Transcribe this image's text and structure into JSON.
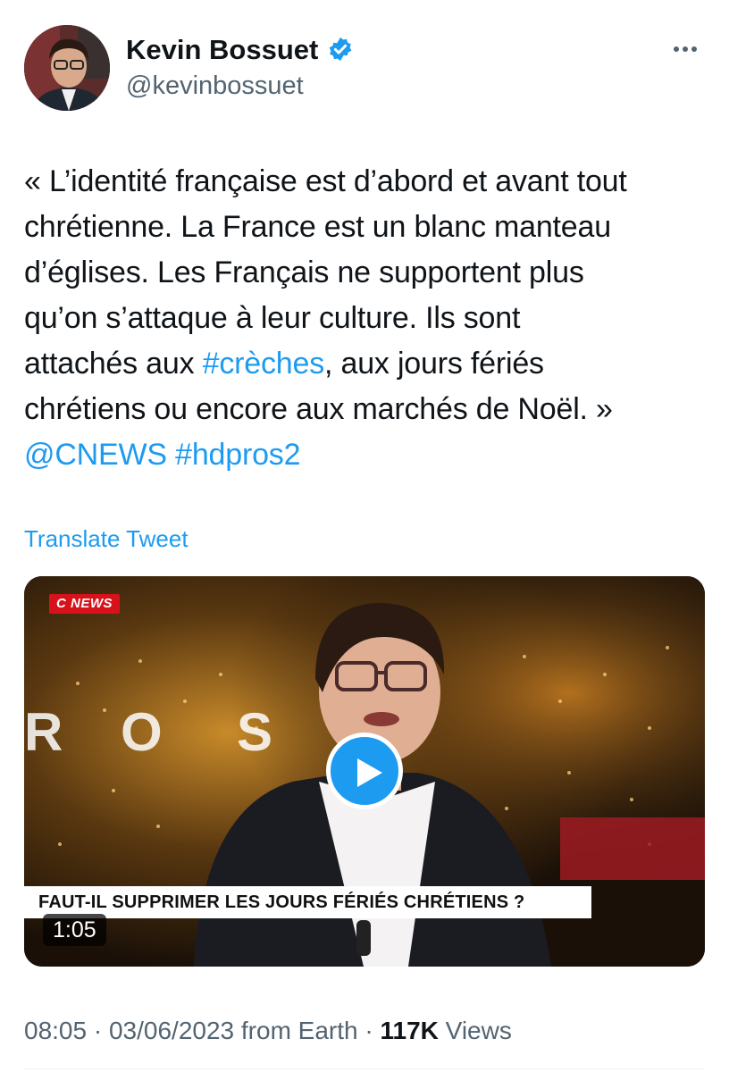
{
  "author": {
    "display_name": "Kevin Bossuet",
    "handle": "@kevinbossuet",
    "verified": true
  },
  "icons": {
    "verified": "verified-badge-icon",
    "more": "more-options-icon",
    "play": "play-icon"
  },
  "tweet": {
    "lines": [
      [
        {
          "text": "« L’identité française est d’abord et avant tout"
        }
      ],
      [
        {
          "text": "chrétienne. La France est un blanc manteau"
        }
      ],
      [
        {
          "text": "d’églises. Les Français ne supportent plus"
        }
      ],
      [
        {
          "text": "qu’on s’attaque à leur culture. Ils sont"
        }
      ],
      [
        {
          "text": "attachés aux "
        },
        {
          "text": "#crèches",
          "link": true
        },
        {
          "text": ", aux jours fériés"
        }
      ],
      [
        {
          "text": "chrétiens ou encore aux marchés de Noël. »"
        }
      ],
      [
        {
          "text": "@CNEWS",
          "link": true
        },
        {
          "text": " "
        },
        {
          "text": "#hdpros2",
          "link": true
        }
      ]
    ],
    "translate_label": "Translate Tweet"
  },
  "video": {
    "channel_logo": "C NEWS",
    "background_text": "R O S",
    "caption": "FAUT-IL SUPPRIMER LES JOURS FÉRIÉS CHRÉTIENS ?",
    "duration": "1:05"
  },
  "meta": {
    "time": "08:05",
    "separator": " · ",
    "date": "03/06/2023",
    "source": " from Earth",
    "views_count": "117K",
    "views_label": " Views"
  },
  "colors": {
    "link": "#1d9bf0",
    "text": "#0f1419",
    "secondary": "#536471"
  }
}
